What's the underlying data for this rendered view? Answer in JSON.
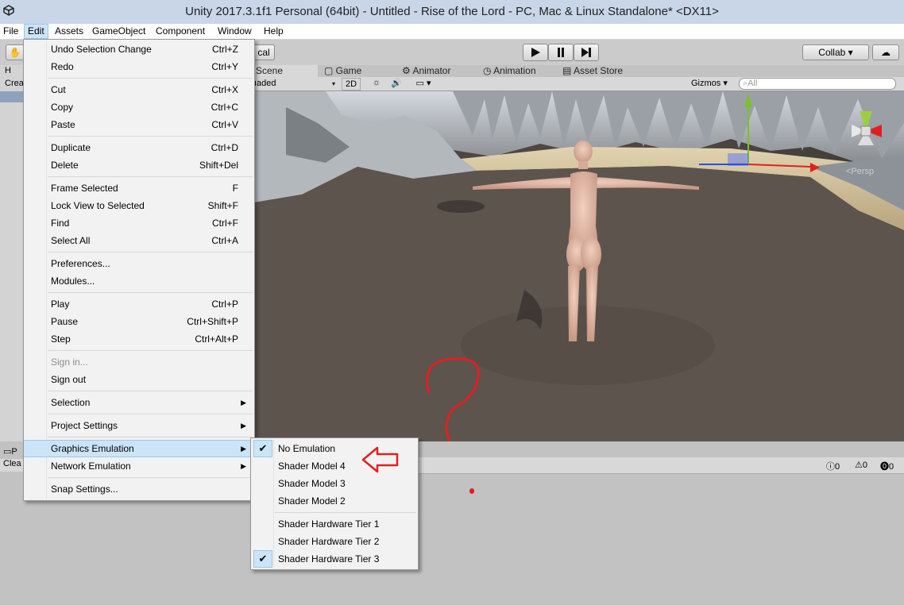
{
  "window": {
    "title": "Unity 2017.3.1f1 Personal (64bit) - Untitled - Rise of the Lord - PC, Mac & Linux Standalone* <DX11>"
  },
  "menubar": {
    "items": [
      "File",
      "Edit",
      "Assets",
      "GameObject",
      "Component",
      "Window",
      "Help"
    ],
    "active": "Edit"
  },
  "toolbar": {
    "pivot_label": "cal",
    "collab_label": "Collab ▾"
  },
  "scene_tabs": {
    "scene": "Scene",
    "game": "Game",
    "animator": "Animator",
    "animation": "Animation",
    "asset_store": "Asset Store"
  },
  "scene_bar": {
    "shading": "ıaded",
    "mode_2d": "2D",
    "gizmos": "Gizmos ▾",
    "search_placeholder": "All"
  },
  "gizmo": {
    "persp_label": "Persp"
  },
  "hierarchy": {
    "tab_label": "H",
    "create_label": "Crea"
  },
  "project": {
    "tab_label": "P",
    "clear_label": "Clea"
  },
  "console": {
    "errors": "0",
    "warnings": "0",
    "messages": "0"
  },
  "edit_menu": {
    "undo": "Undo Selection Change",
    "undo_sc": "Ctrl+Z",
    "redo": "Redo",
    "redo_sc": "Ctrl+Y",
    "cut": "Cut",
    "cut_sc": "Ctrl+X",
    "copy": "Copy",
    "copy_sc": "Ctrl+C",
    "paste": "Paste",
    "paste_sc": "Ctrl+V",
    "duplicate": "Duplicate",
    "duplicate_sc": "Ctrl+D",
    "delete": "Delete",
    "delete_sc": "Shift+Del",
    "frame_selected": "Frame Selected",
    "frame_selected_sc": "F",
    "lock_view": "Lock View to Selected",
    "lock_view_sc": "Shift+F",
    "find": "Find",
    "find_sc": "Ctrl+F",
    "select_all": "Select All",
    "select_all_sc": "Ctrl+A",
    "preferences": "Preferences...",
    "modules": "Modules...",
    "play": "Play",
    "play_sc": "Ctrl+P",
    "pause": "Pause",
    "pause_sc": "Ctrl+Shift+P",
    "step": "Step",
    "step_sc": "Ctrl+Alt+P",
    "sign_in": "Sign in...",
    "sign_out": "Sign out",
    "selection": "Selection",
    "project_settings": "Project Settings",
    "graphics_emulation": "Graphics Emulation",
    "network_emulation": "Network Emulation",
    "snap_settings": "Snap Settings..."
  },
  "graphics_submenu": {
    "items": [
      "No Emulation",
      "Shader Model 4",
      "Shader Model 3",
      "Shader Model 2",
      "Shader Hardware Tier 1",
      "Shader Hardware Tier 2",
      "Shader Hardware Tier 3"
    ],
    "checked": [
      "No Emulation",
      "Shader Hardware Tier 3"
    ]
  },
  "colors": {
    "menu_hover": "#cce4f7",
    "annotation_red": "#e02020"
  },
  "icons": {
    "check": "check-icon",
    "submenu": "submenu-arrow-icon"
  }
}
